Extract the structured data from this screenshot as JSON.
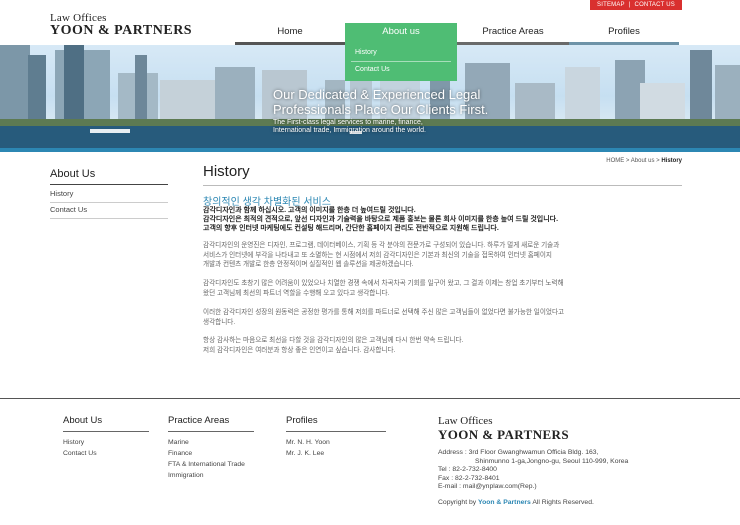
{
  "util": {
    "sitemap": "SITEMAP",
    "sep": "|",
    "contact": "CONTACT US"
  },
  "logo": {
    "line1": "Law Offices",
    "line2": "YOON & PARTNERS"
  },
  "nav": [
    {
      "label": "Home"
    },
    {
      "label": "About us"
    },
    {
      "label": "Practice Areas"
    },
    {
      "label": "Profiles"
    }
  ],
  "submenu": [
    {
      "label": "History"
    },
    {
      "label": "Contact Us"
    }
  ],
  "hero": {
    "line1": "Our Dedicated & Experienced Legal",
    "line2": "Professionals Place Our Clients First.",
    "sub1": "The First-class legal services to marine, finance,",
    "sub2": "International trade, Immigration around the world."
  },
  "sidebar": {
    "title": "About Us",
    "items": [
      {
        "label": "History"
      },
      {
        "label": "Contact Us"
      }
    ]
  },
  "breadcrumb": {
    "home": "HOME",
    "sep1": ">",
    "section": "About us",
    "sep2": ">",
    "current": "History"
  },
  "main": {
    "title": "History",
    "subhead": "창의적인 생각 차별화된 서비스",
    "intro": [
      "감각디자인과 함께 하십시오. 고객의 이미지를 한층 더 높여드릴 것입니다.",
      "감각디자인은 최적의 견적으로, 앞선 디자인과 기술력을 바탕으로 제품 홍보는 물론 회사 이미지를 한층 높여 드릴 것입니다.",
      "고객의 향후 인터넷 마케팅에도 컨설팅 해드리며, 간단한 홈페이지 관리도 전반적으로 지원해 드립니다."
    ],
    "paragraphs": [
      [
        "감각디자인의 운영진은 디자인, 프로그램, 데이터베이스, 기획 등 각 분야의 전문가로 구성되어 있습니다. 하루가 멀게 새로운 기술과",
        "서비스가 인터넷에 부각을 나타내고 또 소멸하는 현 시점에서 저희 감각디자인은 기본과 최신의 기술을 접목하여 인터넷 홈페이지",
        "개발과 컨텐츠 개발로 한층 안정적이며 실질적인 웹 솔루션을 제공하겠습니다."
      ],
      [
        "감각디자인도 초창기 많은 어려움이 있었으나 치열한 경쟁 속에서 차곡차곡 기회를 일구어 왔고, 그 결과 이제는 창업 초기부터 노력해",
        "왔던 고객님께 최선의 파트너 역할을 수행해 오고 있다고 생각합니다."
      ],
      [
        "이러한 감각디자인 성장의 원동력은 공정한 평가를 통해 저희를 파트너로 선택해 주신 많은 고객님들이 없었다면 불가능한 일이었다고",
        "생각합니다."
      ],
      [
        "항상 감사하는 마음으로 최선을 다할 것을 감각디자인의 많은 고객님께 다시 한번 약속 드립니다.",
        "저희 감각디자인은 여러분과 항상 좋은 인연이고 싶습니다. 감사합니다."
      ]
    ]
  },
  "footer": {
    "about": {
      "title": "About Us",
      "items": [
        "History",
        "Contact Us"
      ]
    },
    "practice": {
      "title": "Practice Areas",
      "items": [
        "Marine",
        "Finance",
        "FTA & International Trade",
        "Immigration"
      ]
    },
    "profiles": {
      "title": "Profiles",
      "items": [
        "Mr. N. H. Yoon",
        "Mr. J. K. Lee"
      ]
    },
    "logo": {
      "line1": "Law Offices",
      "line2": "YOON & PARTNERS"
    },
    "address1": "Address : 3rd Floor Gwanghwamun Officia Bldg. 163,",
    "address2": "Shinmunno 1-ga,Jongno-gu, Seoul 110-999, Korea",
    "tel": "Tel : 82-2-732-8400",
    "fax": "Fax : 82-2-732-8401",
    "email": "E-mail : mail@ynplaw.com(Rep.)",
    "copy_prefix": "Copyright by",
    "copy_brand": "Yoon & Partners",
    "copy_suffix": "All Rights Reserved."
  },
  "colors": {
    "accent_green": "#4fbd74",
    "accent_blue": "#2c87b3",
    "util_red": "#d9302f"
  }
}
